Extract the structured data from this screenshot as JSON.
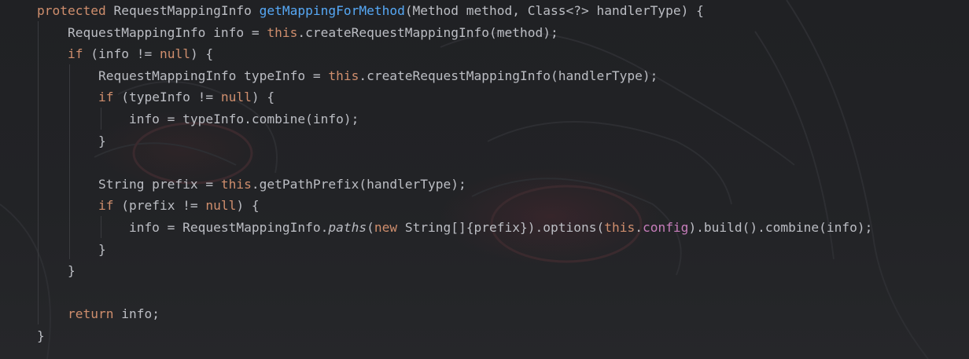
{
  "editor": {
    "language": "java",
    "theme": {
      "background": "#1e1f22",
      "default_text": "#bcbec4",
      "keyword": "#cf8e6d",
      "method_declaration": "#56a8f5",
      "field": "#c77dbb"
    },
    "lines": [
      [
        {
          "t": "protected",
          "k": "kw"
        },
        {
          "t": " RequestMappingInfo "
        },
        {
          "t": "getMappingForMethod",
          "k": "fn"
        },
        {
          "t": "(Method method, Class<?> handlerType) {"
        }
      ],
      [
        {
          "t": "    RequestMappingInfo info = "
        },
        {
          "t": "this",
          "k": "kw"
        },
        {
          "t": ".createRequestMappingInfo(method);"
        }
      ],
      [
        {
          "t": "    "
        },
        {
          "t": "if",
          "k": "kw"
        },
        {
          "t": " (info != "
        },
        {
          "t": "null",
          "k": "kw"
        },
        {
          "t": ") {"
        }
      ],
      [
        {
          "t": "        RequestMappingInfo typeInfo = "
        },
        {
          "t": "this",
          "k": "kw"
        },
        {
          "t": ".createRequestMappingInfo(handlerType);"
        }
      ],
      [
        {
          "t": "        "
        },
        {
          "t": "if",
          "k": "kw"
        },
        {
          "t": " (typeInfo != "
        },
        {
          "t": "null",
          "k": "kw"
        },
        {
          "t": ") {"
        }
      ],
      [
        {
          "t": "            info = typeInfo.combine(info);"
        }
      ],
      [
        {
          "t": "        }"
        }
      ],
      [],
      [
        {
          "t": "        String prefix = "
        },
        {
          "t": "this",
          "k": "kw"
        },
        {
          "t": ".getPathPrefix(handlerType);"
        }
      ],
      [
        {
          "t": "        "
        },
        {
          "t": "if",
          "k": "kw"
        },
        {
          "t": " (prefix != "
        },
        {
          "t": "null",
          "k": "kw"
        },
        {
          "t": ") {"
        }
      ],
      [
        {
          "t": "            info = RequestMappingInfo."
        },
        {
          "t": "paths",
          "k": "it"
        },
        {
          "t": "("
        },
        {
          "t": "new",
          "k": "kw"
        },
        {
          "t": " String[]{prefix}).options("
        },
        {
          "t": "this",
          "k": "kw"
        },
        {
          "t": "."
        },
        {
          "t": "config",
          "k": "fld"
        },
        {
          "t": ").build().combine(info);"
        }
      ],
      [
        {
          "t": "        }"
        }
      ],
      [
        {
          "t": "    }"
        }
      ],
      [],
      [
        {
          "t": "    "
        },
        {
          "t": "return",
          "k": "kw"
        },
        {
          "t": " info;"
        }
      ],
      [
        {
          "t": "}"
        }
      ]
    ]
  }
}
